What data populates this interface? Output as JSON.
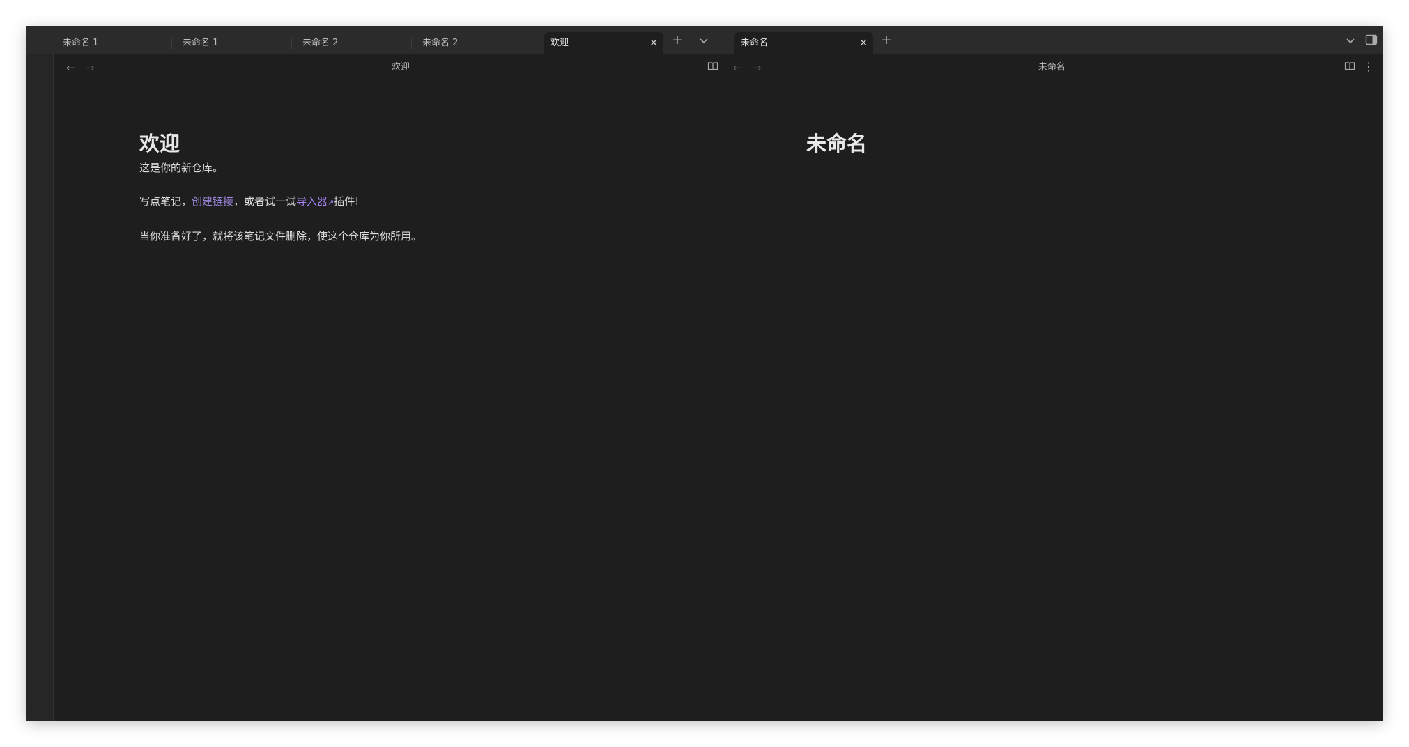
{
  "tabs": [
    {
      "label": "未命名 1"
    },
    {
      "label": "未命名 1"
    },
    {
      "label": "未命名 2"
    },
    {
      "label": "未命名 2"
    },
    {
      "label": "欢迎",
      "active": true
    }
  ],
  "right_tabs": [
    {
      "label": "未命名",
      "active": true
    }
  ],
  "icons": {
    "close": "✕",
    "new_tab": "+",
    "tab_list": "chevron-down",
    "sidebar_toggle": "sidebar-right",
    "back": "←",
    "forward": "→",
    "reading_view": "book-open",
    "more": "⋮",
    "external_link": "↗"
  },
  "left_pane": {
    "title": "欢迎",
    "heading": "欢迎",
    "para1": "这是你的新仓库。",
    "para2_prefix": "写点笔记，",
    "para2_link1": "创建链接",
    "para2_middle": "，或者试一试",
    "para2_link2": "导入器",
    "para2_suffix": "插件!",
    "para3": "当你准备好了，就将该笔记文件删除，使这个仓库为你所用。"
  },
  "right_pane": {
    "title": "未命名",
    "heading": "未命名"
  },
  "colors": {
    "background": "#1e1e1e",
    "tabbar": "#2b2b2b",
    "internal_link": "#9b84d9",
    "external_link": "#a782f6"
  }
}
